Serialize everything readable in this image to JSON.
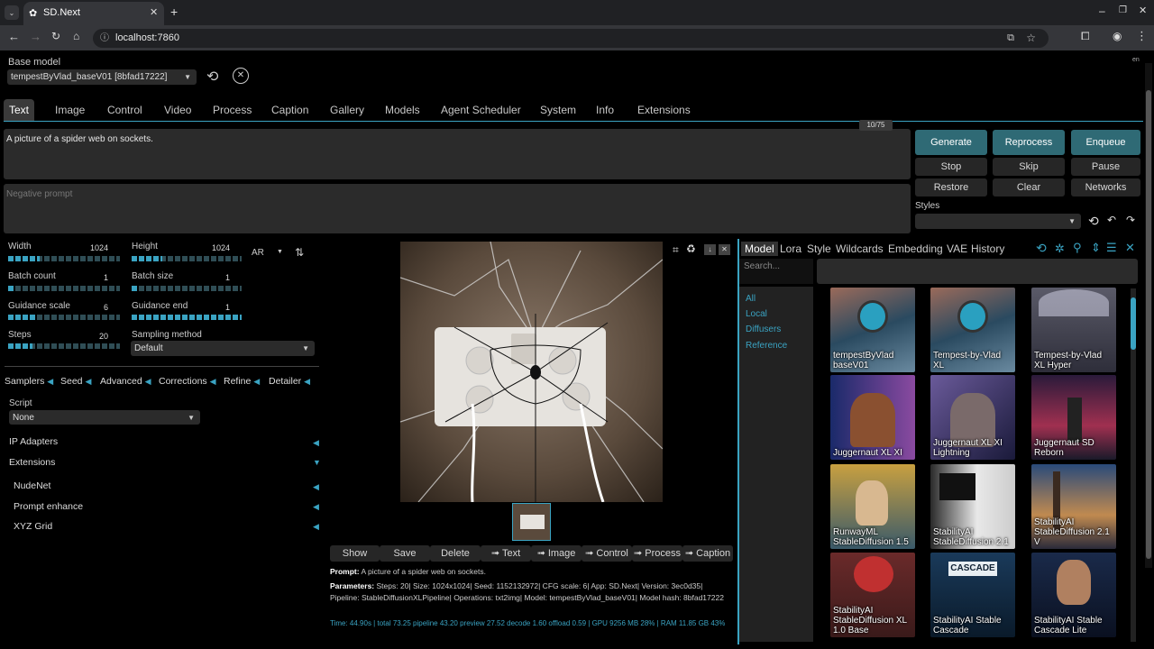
{
  "browser": {
    "tab_title": "SD.Next",
    "url": "localhost:7860"
  },
  "base_model": {
    "label": "Base model",
    "value": "tempestByVlad_baseV01 [8bfad17222]"
  },
  "lang": "en",
  "main_tabs": [
    "Text",
    "Image",
    "Control",
    "Video",
    "Process",
    "Caption",
    "Gallery",
    "Models",
    "Agent Scheduler",
    "System",
    "Info",
    "Extensions"
  ],
  "prompt": {
    "value": "A picture of a spider web on sockets.",
    "token_count": "10/75",
    "negative_placeholder": "Negative prompt"
  },
  "actions": {
    "generate": "Generate",
    "reprocess": "Reprocess",
    "enqueue": "Enqueue",
    "stop": "Stop",
    "skip": "Skip",
    "pause": "Pause",
    "restore": "Restore",
    "clear": "Clear",
    "networks": "Networks",
    "styles_label": "Styles"
  },
  "params": {
    "width": {
      "label": "Width",
      "value": "1024",
      "fraction": 0.28
    },
    "height": {
      "label": "Height",
      "value": "1024",
      "fraction": 0.28
    },
    "ar": "AR",
    "batch_count": {
      "label": "Batch count",
      "value": "1",
      "fraction": 0.05
    },
    "batch_size": {
      "label": "Batch size",
      "value": "1",
      "fraction": 0.05
    },
    "guidance_scale": {
      "label": "Guidance scale",
      "value": "6",
      "fraction": 0.25
    },
    "guidance_end": {
      "label": "Guidance end",
      "value": "1",
      "fraction": 1.0
    },
    "steps": {
      "label": "Steps",
      "value": "20",
      "fraction": 0.22
    },
    "sampling_method": {
      "label": "Sampling method",
      "value": "Default"
    }
  },
  "sub_sections": [
    "Samplers",
    "Seed",
    "Advanced",
    "Corrections",
    "Refine",
    "Detailer"
  ],
  "script": {
    "label": "Script",
    "value": "None"
  },
  "accordions": [
    {
      "label": "IP Adapters",
      "arrow": "◀"
    },
    {
      "label": "Extensions",
      "arrow": "▼"
    },
    {
      "label": "NudeNet",
      "arrow": "◀"
    },
    {
      "label": "Prompt enhance",
      "arrow": "◀"
    },
    {
      "label": "XYZ Grid",
      "arrow": "◀"
    }
  ],
  "output_buttons": [
    "Show",
    "Save",
    "Delete",
    "➟ Text",
    "➟ Image",
    "➟ Control",
    "➟ Process",
    "➟ Caption"
  ],
  "generation_info": {
    "prompt_label": "Prompt:",
    "prompt_value": "A picture of a spider web on sockets.",
    "params_label": "Parameters:",
    "params_value": "Steps: 20| Size: 1024x1024| Seed: 1152132972| CFG scale: 6| App: SD.Next| Version: 3ec0d35| Pipeline: StableDiffusionXLPipeline| Operations: txt2img| Model: tempestByVlad_baseV01| Model hash: 8bfad17222",
    "timing": "Time: 44.90s | total 73.25 pipeline 43.20 preview 27.52 decode 1.60 offload 0.59 | GPU 9256 MB 28% | RAM 11.85 GB 43%"
  },
  "networks": {
    "tabs": [
      "Model",
      "Lora",
      "Style",
      "Wildcards",
      "Embedding",
      "VAE",
      "History"
    ],
    "active_tab": "Model",
    "search_placeholder": "Search...",
    "filters": [
      "All",
      "Local",
      "Diffusers",
      "Reference"
    ],
    "cards": [
      {
        "name": "tempestByVlad baseV01"
      },
      {
        "name": "Tempest-by-Vlad XL"
      },
      {
        "name": "Tempest-by-Vlad XL Hyper"
      },
      {
        "name": "Juggernaut XL XI"
      },
      {
        "name": "Juggernaut XL XI Lightning"
      },
      {
        "name": "Juggernaut SD Reborn"
      },
      {
        "name": "RunwayML StableDiffusion 1.5"
      },
      {
        "name": "StabilityAI StableDiffusion 2.1"
      },
      {
        "name": "StabilityAI StableDiffusion 2.1 V"
      },
      {
        "name": "StabilityAI StableDiffusion XL 1.0 Base"
      },
      {
        "name": "StabilityAI Stable Cascade"
      },
      {
        "name": "StabilityAI Stable Cascade Lite"
      }
    ],
    "cascade_sign": "CASCADE"
  },
  "colors": {
    "accent": "#3aa3c2",
    "teal_button": "#2f6a75"
  }
}
